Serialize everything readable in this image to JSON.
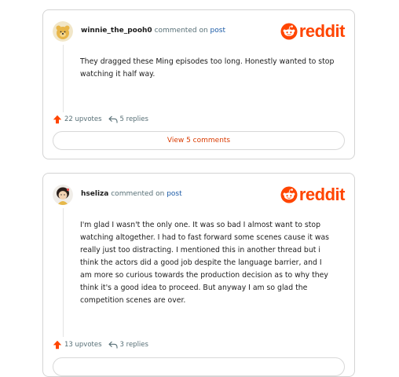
{
  "brand": {
    "name": "reddit",
    "color": "#ff4500"
  },
  "comments": [
    {
      "username": "winnie_the_pooh0",
      "meta_text": "commented on",
      "meta_link": "post",
      "body": "They dragged these Ming episodes too long. Honestly wanted to stop watching it half way.",
      "upvotes": "22 upvotes",
      "replies": "5 replies",
      "view_comments": "View 5 comments"
    },
    {
      "username": "hseliza",
      "meta_text": "commented on",
      "meta_link": "post",
      "body": "I'm glad I wasn't the only one. It was so bad I almost want to stop watching altogether. I had to fast forward some scenes cause it was really just too distracting. I mentioned this in another thread but i think the actors did a good job despite the language barrier, and I am more so curious towards the production decision as to why they think it's a good idea to proceed. But anyway I am so glad the competition scenes are over.",
      "upvotes": "13 upvotes",
      "replies": "3 replies"
    }
  ]
}
